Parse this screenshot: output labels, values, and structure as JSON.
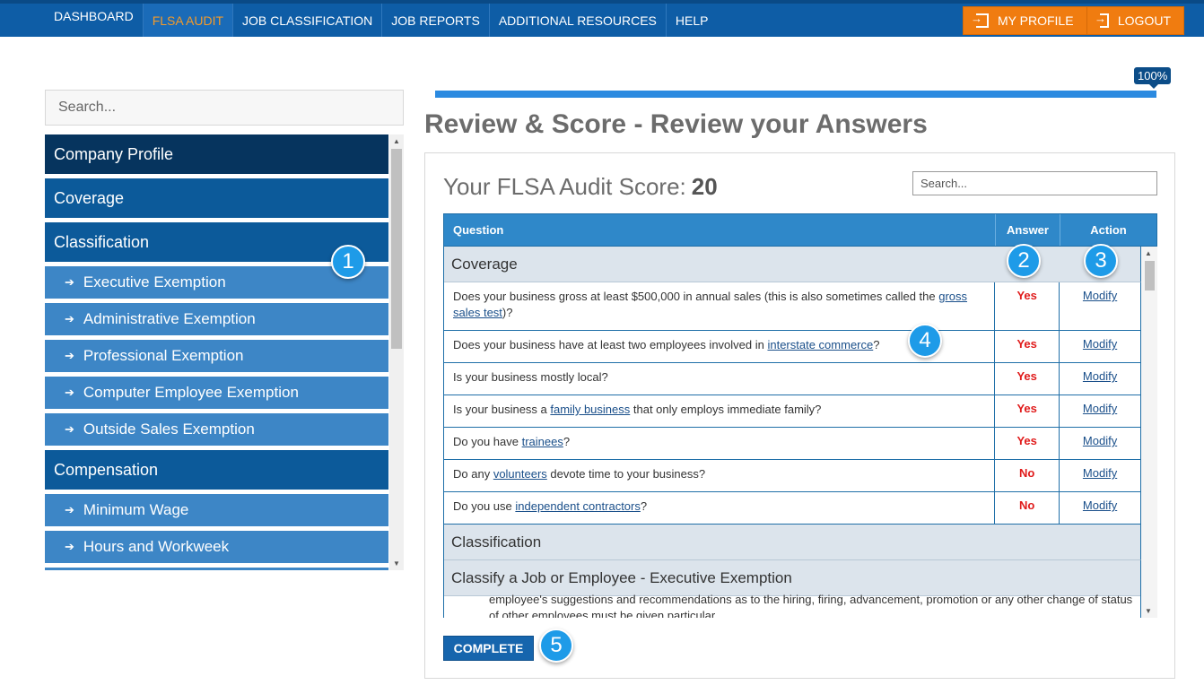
{
  "nav": {
    "items": [
      "DASHBOARD",
      "FLSA AUDIT",
      "JOB CLASSIFICATION",
      "JOB REPORTS",
      "ADDITIONAL RESOURCES",
      "HELP"
    ],
    "active_index": 1,
    "my_profile": "MY PROFILE",
    "logout": "LOGOUT"
  },
  "sidebar": {
    "search_placeholder": "Search...",
    "items": [
      {
        "label": "Company Profile",
        "type": "section"
      },
      {
        "label": "Coverage",
        "type": "section"
      },
      {
        "label": "Classification",
        "type": "section"
      },
      {
        "label": "Executive Exemption",
        "type": "sub"
      },
      {
        "label": "Administrative Exemption",
        "type": "sub"
      },
      {
        "label": "Professional Exemption",
        "type": "sub"
      },
      {
        "label": "Computer Employee Exemption",
        "type": "sub"
      },
      {
        "label": "Outside Sales Exemption",
        "type": "sub"
      },
      {
        "label": "Compensation",
        "type": "section"
      },
      {
        "label": "Minimum Wage",
        "type": "sub"
      },
      {
        "label": "Hours and Workweek",
        "type": "sub"
      }
    ]
  },
  "progress": {
    "value": 1.0,
    "label": "100%"
  },
  "page_title": "Review & Score - Review your Answers",
  "score": {
    "label": "Your FLSA Audit Score:",
    "value": "20"
  },
  "table": {
    "search_placeholder": "Search...",
    "headers": {
      "question": "Question",
      "answer": "Answer",
      "action": "Action"
    },
    "group1": "Coverage",
    "rows": [
      {
        "pre": "Does your business gross at least $500,000 in annual sales (this is also sometimes called the ",
        "link": "gross sales test",
        "post": ")?",
        "answer": "Yes",
        "action": "Modify"
      },
      {
        "pre": "Does your business have at least two employees involved in ",
        "link": "interstate commerce",
        "post": "?",
        "answer": "Yes",
        "action": "Modify"
      },
      {
        "pre": "Is your business mostly local?",
        "link": "",
        "post": "",
        "answer": "Yes",
        "action": "Modify"
      },
      {
        "pre": "Is your business a ",
        "link": "family business",
        "post": " that only employs immediate family?",
        "answer": "Yes",
        "action": "Modify"
      },
      {
        "pre": "Do you have ",
        "link": "trainees",
        "post": "?",
        "answer": "Yes",
        "action": "Modify"
      },
      {
        "pre": "Do any ",
        "link": "volunteers",
        "post": " devote time to your business?",
        "answer": "No",
        "action": "Modify"
      },
      {
        "pre": "Do you use ",
        "link": "independent contractors",
        "post": "?",
        "answer": "No",
        "action": "Modify"
      }
    ],
    "group2": "Classification",
    "group3": "Classify a Job or Employee - Executive Exemption",
    "cut_text": "employee's suggestions and recommendations as to the hiring, firing, advancement, promotion or any other change of status of other employees must be given particular"
  },
  "complete_button": "COMPLETE",
  "callouts": [
    "1",
    "2",
    "3",
    "4",
    "5"
  ]
}
